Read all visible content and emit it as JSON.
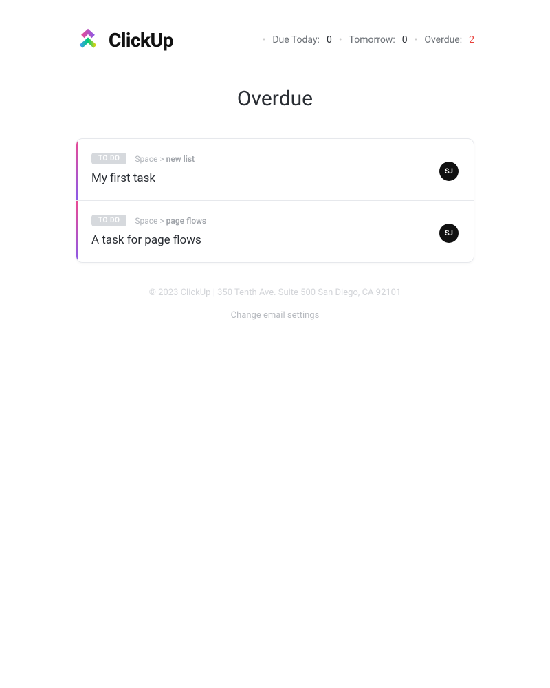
{
  "brand": {
    "name": "ClickUp"
  },
  "summary": {
    "items": [
      {
        "label": "Due Today:",
        "value": "0",
        "highlight": false
      },
      {
        "label": "Tomorrow:",
        "value": "0",
        "highlight": false
      },
      {
        "label": "Overdue:",
        "value": "2",
        "highlight": true
      }
    ]
  },
  "section": {
    "title": "Overdue"
  },
  "tasks": [
    {
      "status": "TO DO",
      "breadcrumb_parent": "Space",
      "breadcrumb_sep": ">",
      "breadcrumb_leaf": "new list",
      "title": "My first task",
      "avatar_initials": "SJ"
    },
    {
      "status": "TO DO",
      "breadcrumb_parent": "Space",
      "breadcrumb_sep": ">",
      "breadcrumb_leaf": "page flows",
      "title": "A task for page flows",
      "avatar_initials": "SJ"
    }
  ],
  "footer": {
    "copyright": "© 2023 ClickUp | 350 Tenth Ave. Suite 500 San Diego, CA 92101",
    "settings_link": "Change email settings"
  }
}
